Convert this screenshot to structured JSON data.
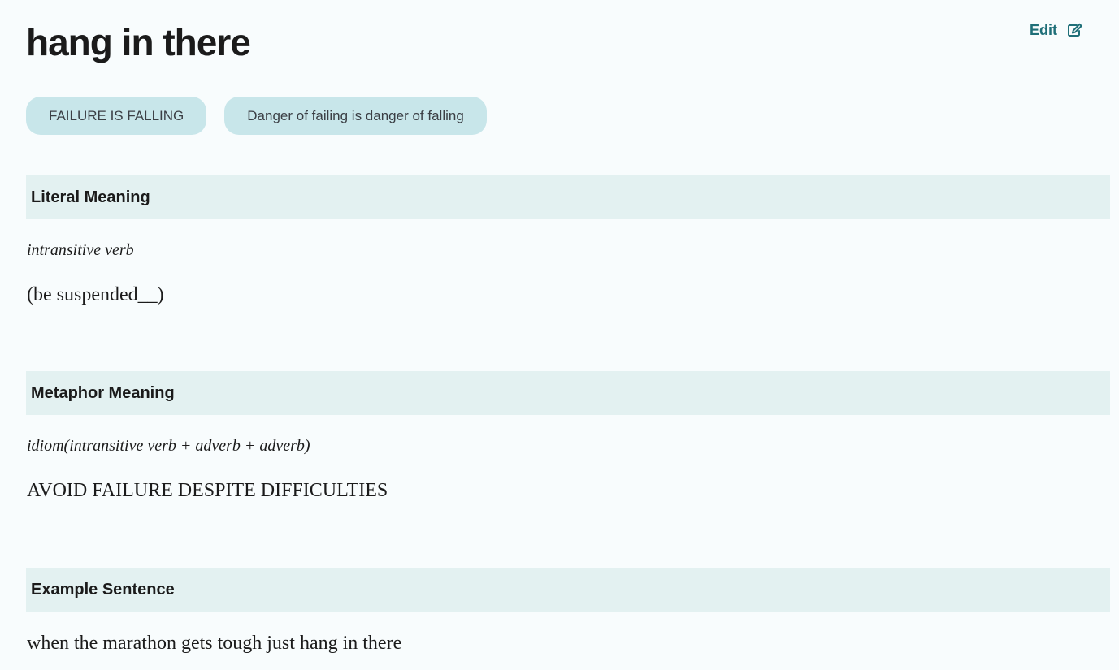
{
  "entry": {
    "title": "hang in there",
    "edit_label": "Edit"
  },
  "icons": {
    "edit": "edit-icon"
  },
  "tags": [
    {
      "label": "FAILURE IS FALLING"
    },
    {
      "label": "Danger of failing is danger of falling"
    }
  ],
  "literal": {
    "heading": "Literal Meaning",
    "part_of_speech": "intransitive verb",
    "meaning": "(be suspended__)"
  },
  "metaphor": {
    "heading": "Metaphor Meaning",
    "part_of_speech": "idiom(intransitive verb + adverb + adverb)",
    "meaning": "AVOID FAILURE DESPITE DIFFICULTIES"
  },
  "example": {
    "heading": "Example Sentence",
    "sentence": "when the marathon gets tough just hang in there"
  },
  "colors": {
    "accent": "#1f6f78",
    "tag_background": "#c8e6ea",
    "section_background": "#e3f1f1",
    "page_background": "#f8fcfd"
  }
}
